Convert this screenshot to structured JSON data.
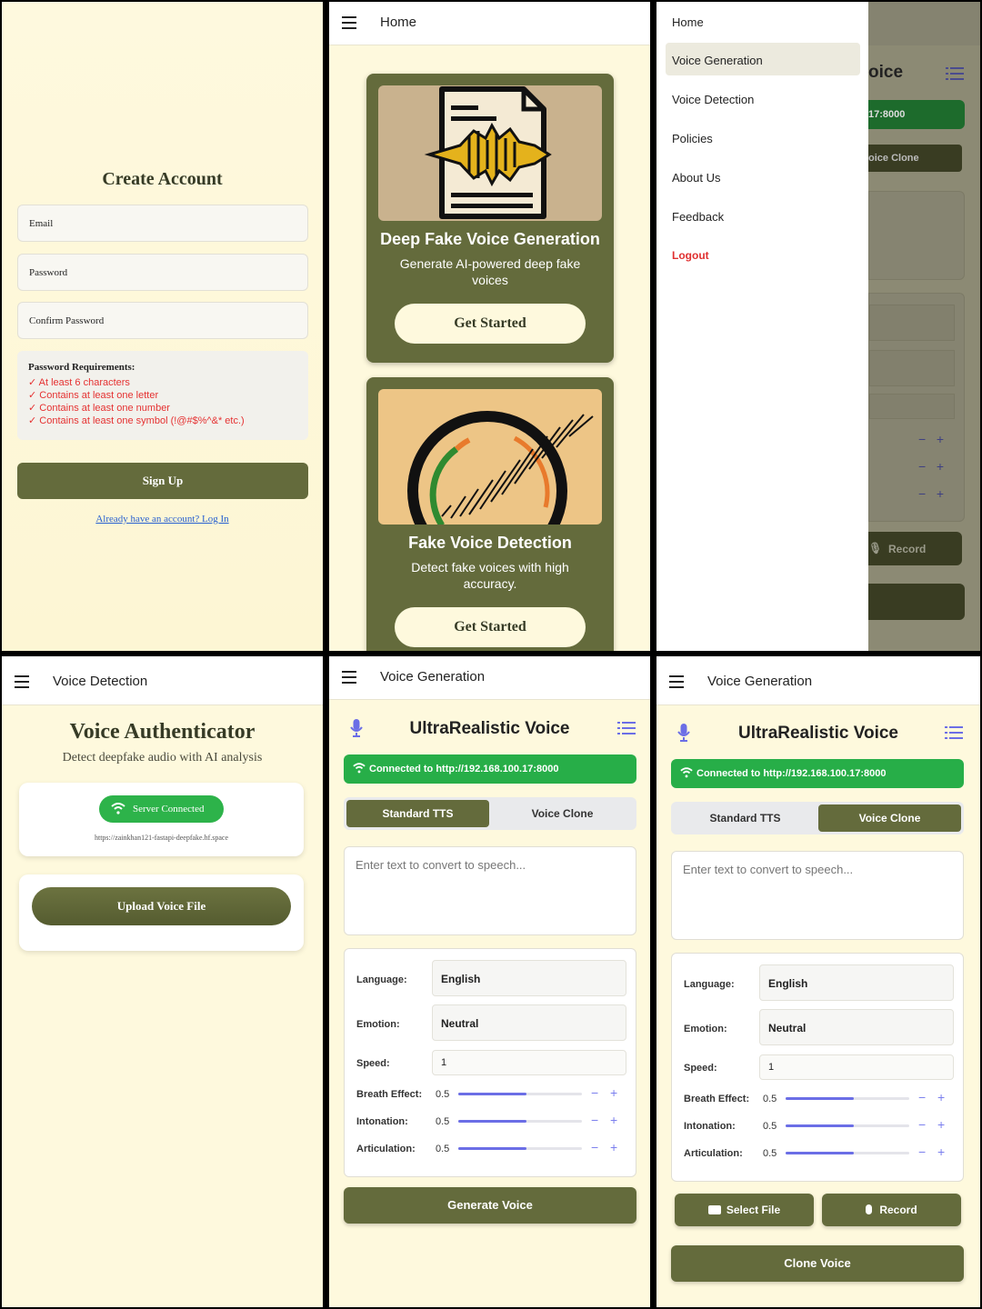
{
  "signup": {
    "title": "Create Account",
    "email_placeholder": "Email",
    "password_placeholder": "Password",
    "confirm_placeholder": "Confirm Password",
    "req_heading": "Password Requirements:",
    "requirements": [
      "✓ At least 6 characters",
      "✓ Contains at least one letter",
      "✓ Contains at least one number",
      "✓ Contains at least one symbol (!@#$%^&* etc.)"
    ],
    "signup_label": "Sign Up",
    "login_link": "Already have an account? Log In"
  },
  "home": {
    "appbar_title": "Home",
    "cards": [
      {
        "title": "Deep Fake Voice Generation",
        "desc": "Generate AI-powered deep fake voices",
        "button": "Get Started",
        "icon": "document-waveform-icon"
      },
      {
        "title": "Fake Voice Detection",
        "desc": "Detect fake voices with high accuracy.",
        "button": "Get Started",
        "icon": "magnifier-waveform-icon"
      }
    ]
  },
  "drawer": {
    "items": [
      "Home",
      "Voice Generation",
      "Voice Detection",
      "Policies",
      "About Us",
      "Feedback",
      "Logout"
    ],
    "active": "Voice Generation",
    "logout_color": "#e03030",
    "behind": {
      "title_fragment": "oice",
      "url_fragment": "17:8000",
      "tab_fragment": "oice Clone",
      "record_label": "Record"
    }
  },
  "detection": {
    "appbar_title": "Voice Detection",
    "title": "Voice Authenticator",
    "subtitle": "Detect deepfake audio with AI analysis",
    "status": "Server Connected",
    "server_url": "https://zainkhan121-fastapi-deepfake.hf.space",
    "upload_label": "Upload Voice File"
  },
  "generation": {
    "appbar_title": "Voice Generation",
    "title": "UltraRealistic Voice",
    "connection": "Connected to http://192.168.100.17:8000",
    "tabs": [
      "Standard TTS",
      "Voice Clone"
    ],
    "text_placeholder": "Enter text to convert to speech...",
    "language_label": "Language:",
    "language": "English",
    "emotion_label": "Emotion:",
    "emotion": "Neutral",
    "speed_label": "Speed:",
    "speed": "1",
    "breath_label": "Breath Effect:",
    "breath": "0.5",
    "intonation_label": "Intonation:",
    "intonation": "0.5",
    "articulation_label": "Articulation:",
    "articulation": "0.5",
    "slider_levels": {
      "breath": 0.55,
      "intonation": 0.55,
      "articulation": 0.55
    },
    "generate_label": "Generate Voice",
    "select_file_label": "Select File",
    "record_label": "Record",
    "clone_label": "Clone Voice",
    "colors": {
      "accent": "#646b3c",
      "connected": "#27ae48",
      "icon": "#6b6ee6"
    }
  }
}
